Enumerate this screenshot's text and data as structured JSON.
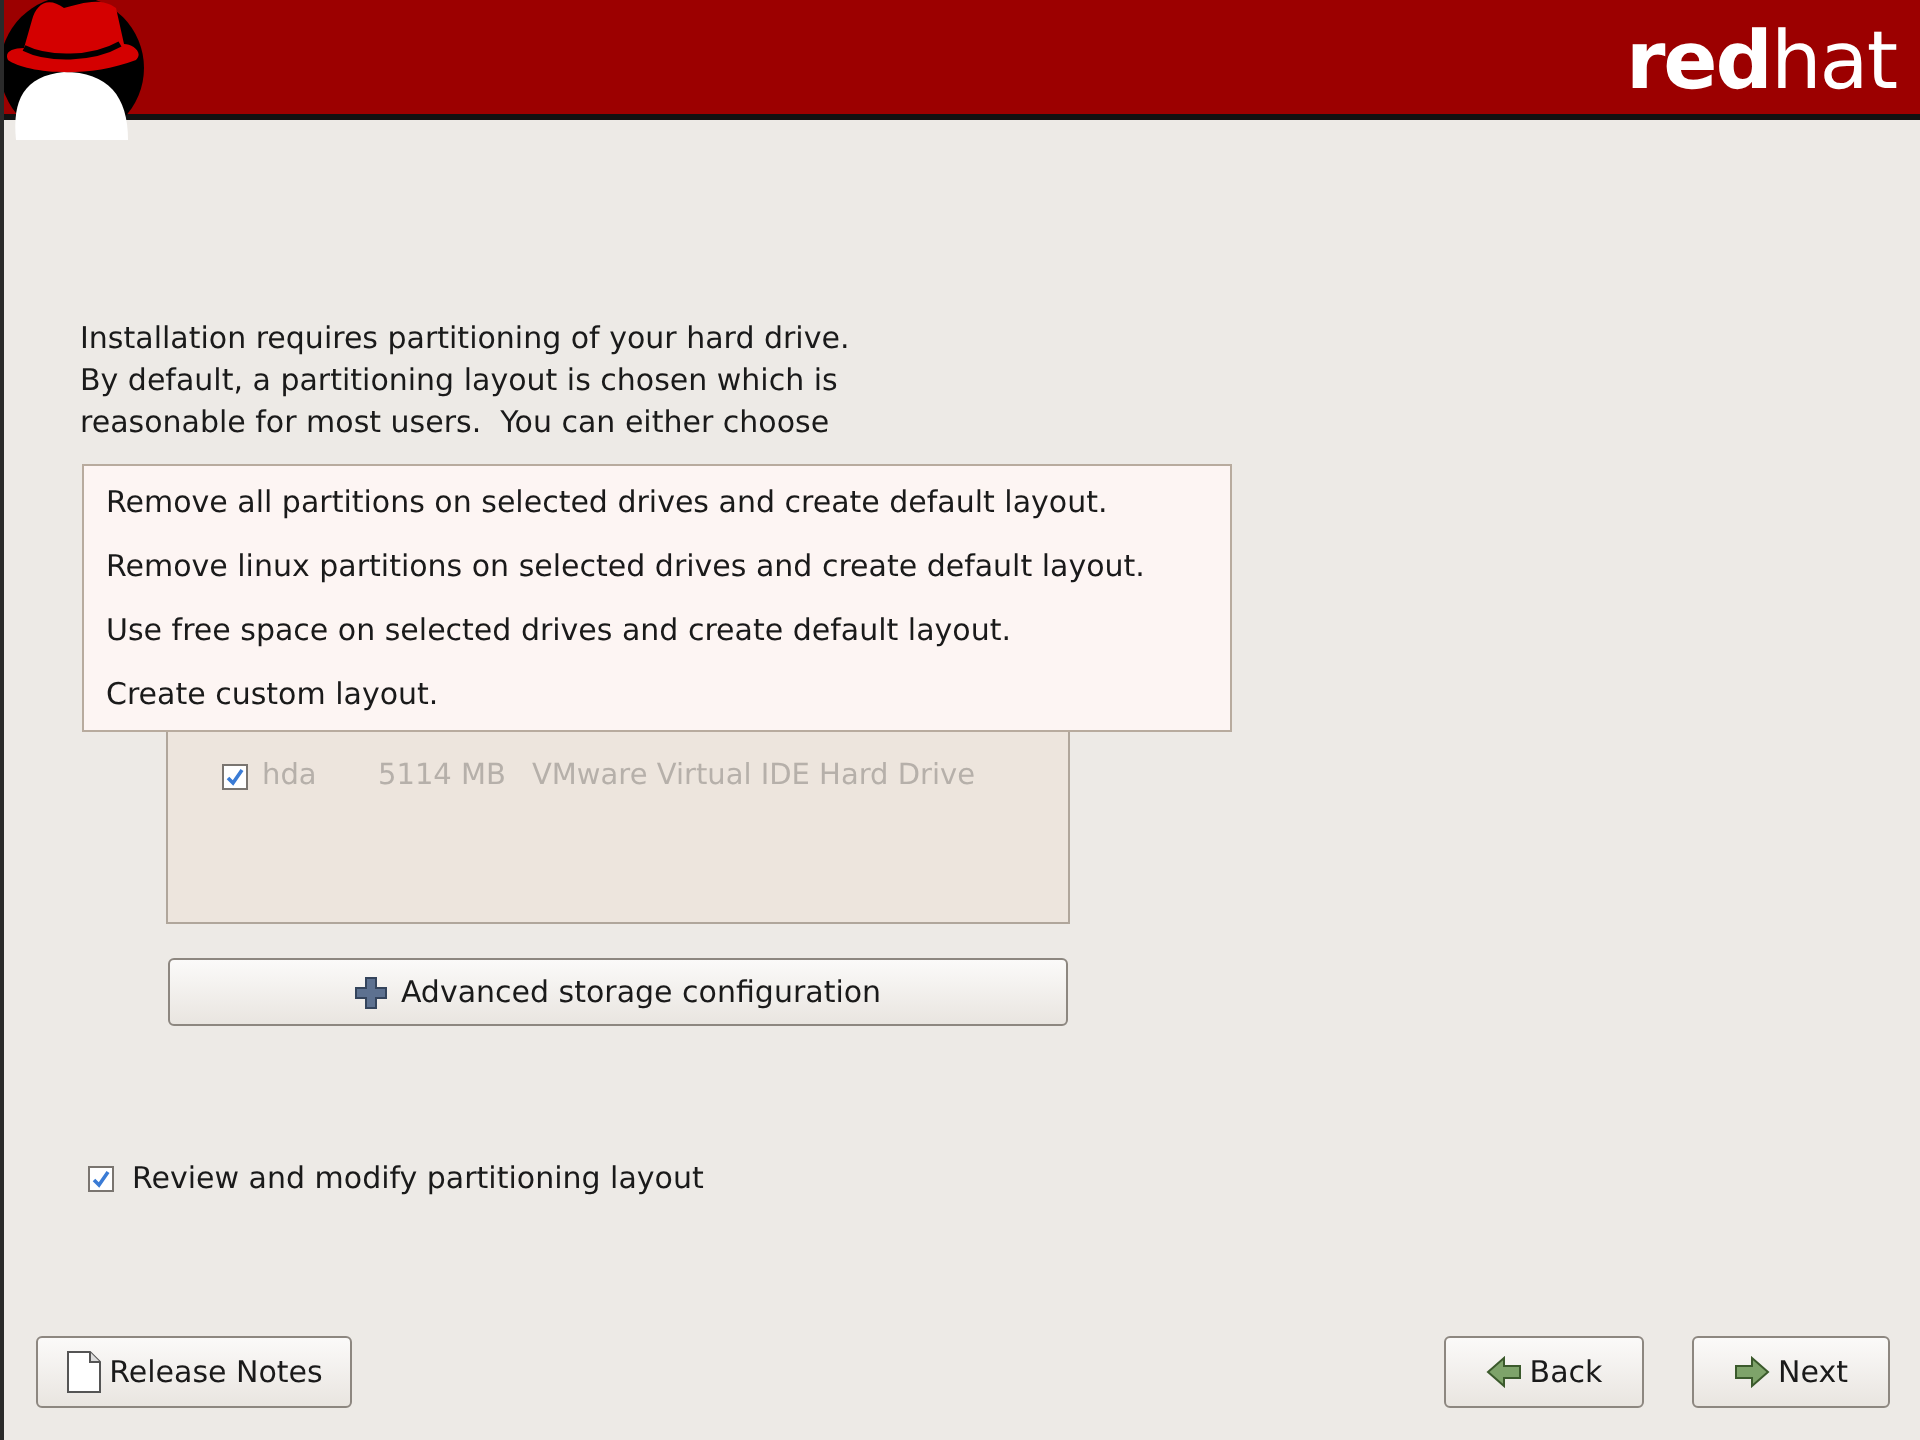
{
  "header": {
    "brand": "**red**hat"
  },
  "intro": "Installation requires partitioning of your hard drive.\nBy default, a partitioning layout is chosen which is\nreasonable for most users.  You can either choose",
  "layout_menu": {
    "options": [
      {
        "label": "Remove all partitions on selected drives and create default layout.",
        "selected": false
      },
      {
        "label": "Remove linux partitions on selected drives and create default layout.",
        "selected": false
      },
      {
        "label": "Use free space on selected drives and create default layout.",
        "selected": false
      },
      {
        "label": "Create custom layout.",
        "selected": false
      }
    ]
  },
  "drives": {
    "disabled": true,
    "rows": [
      {
        "checked": true,
        "name": "hda",
        "size": "5114 MB",
        "model": "VMware Virtual IDE Hard Drive"
      }
    ]
  },
  "advanced_button": {
    "label": "Advanced storage configuration"
  },
  "review": {
    "label": "Review and modify partitioning layout",
    "checked": true
  },
  "buttons": [
    {
      "kind": "notes",
      "label": "Release Notes"
    },
    {
      "kind": "back",
      "label": "Back"
    },
    {
      "kind": "next",
      "label": "Next"
    }
  ]
}
